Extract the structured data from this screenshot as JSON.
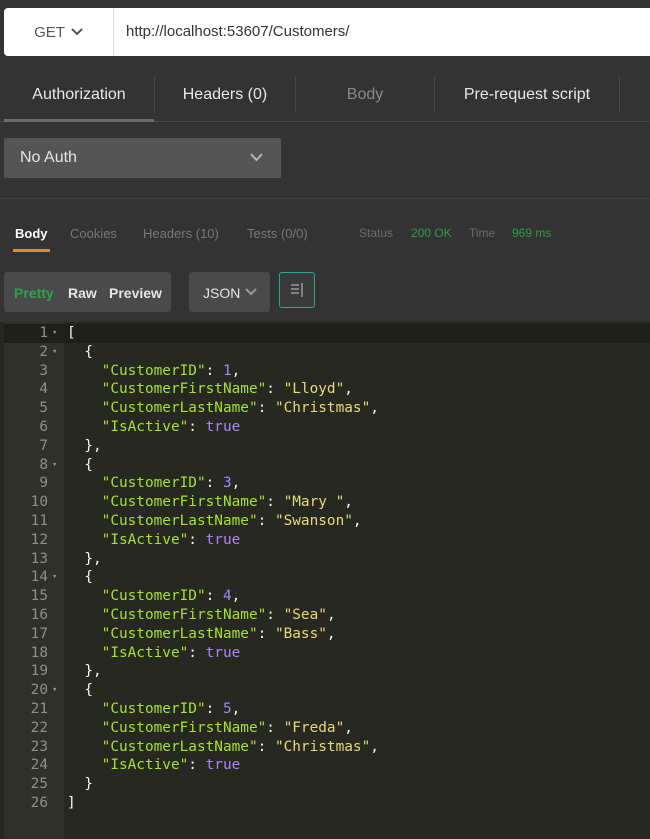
{
  "request": {
    "method": "GET",
    "url": "http://localhost:53607/Customers/"
  },
  "request_tabs": {
    "authorization": "Authorization",
    "headers": "Headers (0)",
    "body": "Body",
    "prerequest": "Pre-request script"
  },
  "auth": {
    "selected": "No Auth"
  },
  "response_tabs": {
    "body": "Body",
    "cookies": "Cookies",
    "headers": "Headers (10)",
    "tests": "Tests (0/0)",
    "status_label": "Status",
    "status_value": "200 OK",
    "time_label": "Time",
    "time_value": "969 ms"
  },
  "view": {
    "pretty": "Pretty",
    "raw": "Raw",
    "preview": "Preview",
    "format": "JSON",
    "wrap_icon": "wrap-lines-icon"
  },
  "colors": {
    "accent_orange": "#e68a26",
    "status_green": "#2f9b4a",
    "json_key": "#a6e22e",
    "json_string": "#e6db74",
    "json_number": "#ae81ff"
  },
  "editor": {
    "lines": [
      {
        "num": "1",
        "fold": true,
        "parts": [
          {
            "t": "p",
            "v": "["
          }
        ]
      },
      {
        "num": "2",
        "fold": true,
        "parts": [
          {
            "t": "p",
            "v": "  {"
          }
        ]
      },
      {
        "num": "3",
        "parts": [
          {
            "t": "p",
            "v": "    "
          },
          {
            "t": "k",
            "v": "\"CustomerID\""
          },
          {
            "t": "p",
            "v": ": "
          },
          {
            "t": "n",
            "v": "1"
          },
          {
            "t": "p",
            "v": ","
          }
        ]
      },
      {
        "num": "4",
        "parts": [
          {
            "t": "p",
            "v": "    "
          },
          {
            "t": "k",
            "v": "\"CustomerFirstName\""
          },
          {
            "t": "p",
            "v": ": "
          },
          {
            "t": "s",
            "v": "\"Lloyd\""
          },
          {
            "t": "p",
            "v": ","
          }
        ]
      },
      {
        "num": "5",
        "parts": [
          {
            "t": "p",
            "v": "    "
          },
          {
            "t": "k",
            "v": "\"CustomerLastName\""
          },
          {
            "t": "p",
            "v": ": "
          },
          {
            "t": "s",
            "v": "\"Christmas\""
          },
          {
            "t": "p",
            "v": ","
          }
        ]
      },
      {
        "num": "6",
        "parts": [
          {
            "t": "p",
            "v": "    "
          },
          {
            "t": "k",
            "v": "\"IsActive\""
          },
          {
            "t": "p",
            "v": ": "
          },
          {
            "t": "n",
            "v": "true"
          }
        ]
      },
      {
        "num": "7",
        "parts": [
          {
            "t": "p",
            "v": "  },"
          }
        ]
      },
      {
        "num": "8",
        "fold": true,
        "parts": [
          {
            "t": "p",
            "v": "  {"
          }
        ]
      },
      {
        "num": "9",
        "parts": [
          {
            "t": "p",
            "v": "    "
          },
          {
            "t": "k",
            "v": "\"CustomerID\""
          },
          {
            "t": "p",
            "v": ": "
          },
          {
            "t": "n",
            "v": "3"
          },
          {
            "t": "p",
            "v": ","
          }
        ]
      },
      {
        "num": "10",
        "parts": [
          {
            "t": "p",
            "v": "    "
          },
          {
            "t": "k",
            "v": "\"CustomerFirstName\""
          },
          {
            "t": "p",
            "v": ": "
          },
          {
            "t": "s",
            "v": "\"Mary \""
          },
          {
            "t": "p",
            "v": ","
          }
        ]
      },
      {
        "num": "11",
        "parts": [
          {
            "t": "p",
            "v": "    "
          },
          {
            "t": "k",
            "v": "\"CustomerLastName\""
          },
          {
            "t": "p",
            "v": ": "
          },
          {
            "t": "s",
            "v": "\"Swanson\""
          },
          {
            "t": "p",
            "v": ","
          }
        ]
      },
      {
        "num": "12",
        "parts": [
          {
            "t": "p",
            "v": "    "
          },
          {
            "t": "k",
            "v": "\"IsActive\""
          },
          {
            "t": "p",
            "v": ": "
          },
          {
            "t": "n",
            "v": "true"
          }
        ]
      },
      {
        "num": "13",
        "parts": [
          {
            "t": "p",
            "v": "  },"
          }
        ]
      },
      {
        "num": "14",
        "fold": true,
        "parts": [
          {
            "t": "p",
            "v": "  {"
          }
        ]
      },
      {
        "num": "15",
        "parts": [
          {
            "t": "p",
            "v": "    "
          },
          {
            "t": "k",
            "v": "\"CustomerID\""
          },
          {
            "t": "p",
            "v": ": "
          },
          {
            "t": "n",
            "v": "4"
          },
          {
            "t": "p",
            "v": ","
          }
        ]
      },
      {
        "num": "16",
        "parts": [
          {
            "t": "p",
            "v": "    "
          },
          {
            "t": "k",
            "v": "\"CustomerFirstName\""
          },
          {
            "t": "p",
            "v": ": "
          },
          {
            "t": "s",
            "v": "\"Sea\""
          },
          {
            "t": "p",
            "v": ","
          }
        ]
      },
      {
        "num": "17",
        "parts": [
          {
            "t": "p",
            "v": "    "
          },
          {
            "t": "k",
            "v": "\"CustomerLastName\""
          },
          {
            "t": "p",
            "v": ": "
          },
          {
            "t": "s",
            "v": "\"Bass\""
          },
          {
            "t": "p",
            "v": ","
          }
        ]
      },
      {
        "num": "18",
        "parts": [
          {
            "t": "p",
            "v": "    "
          },
          {
            "t": "k",
            "v": "\"IsActive\""
          },
          {
            "t": "p",
            "v": ": "
          },
          {
            "t": "n",
            "v": "true"
          }
        ]
      },
      {
        "num": "19",
        "parts": [
          {
            "t": "p",
            "v": "  },"
          }
        ]
      },
      {
        "num": "20",
        "fold": true,
        "parts": [
          {
            "t": "p",
            "v": "  {"
          }
        ]
      },
      {
        "num": "21",
        "parts": [
          {
            "t": "p",
            "v": "    "
          },
          {
            "t": "k",
            "v": "\"CustomerID\""
          },
          {
            "t": "p",
            "v": ": "
          },
          {
            "t": "n",
            "v": "5"
          },
          {
            "t": "p",
            "v": ","
          }
        ]
      },
      {
        "num": "22",
        "parts": [
          {
            "t": "p",
            "v": "    "
          },
          {
            "t": "k",
            "v": "\"CustomerFirstName\""
          },
          {
            "t": "p",
            "v": ": "
          },
          {
            "t": "s",
            "v": "\"Freda\""
          },
          {
            "t": "p",
            "v": ","
          }
        ]
      },
      {
        "num": "23",
        "parts": [
          {
            "t": "p",
            "v": "    "
          },
          {
            "t": "k",
            "v": "\"CustomerLastName\""
          },
          {
            "t": "p",
            "v": ": "
          },
          {
            "t": "s",
            "v": "\"Christmas\""
          },
          {
            "t": "p",
            "v": ","
          }
        ]
      },
      {
        "num": "24",
        "parts": [
          {
            "t": "p",
            "v": "    "
          },
          {
            "t": "k",
            "v": "\"IsActive\""
          },
          {
            "t": "p",
            "v": ": "
          },
          {
            "t": "n",
            "v": "true"
          }
        ]
      },
      {
        "num": "25",
        "parts": [
          {
            "t": "p",
            "v": "  }"
          }
        ]
      },
      {
        "num": "26",
        "parts": [
          {
            "t": "p",
            "v": "]"
          }
        ]
      }
    ]
  }
}
